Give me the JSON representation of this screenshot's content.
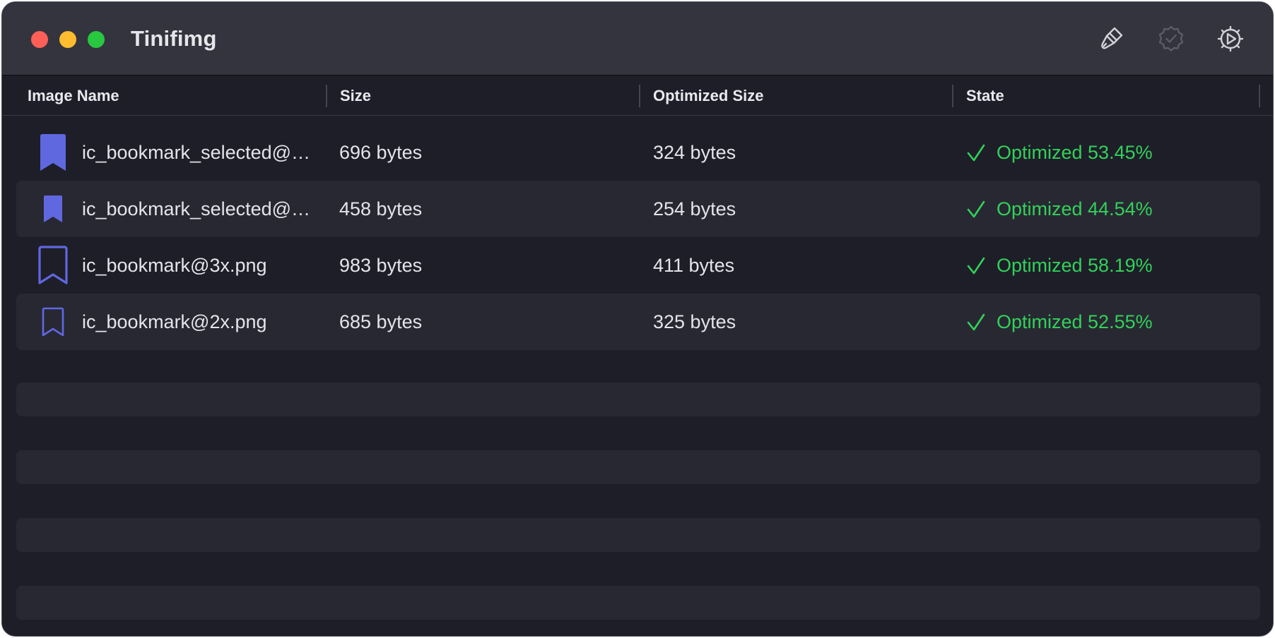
{
  "window": {
    "title": "Tinifimg",
    "traffic_lights": {
      "close_color": "#fe5f57",
      "minimize_color": "#febc2e",
      "zoom_color": "#28c840"
    }
  },
  "toolbar": {
    "buttons": [
      {
        "icon": "paintbrush-icon",
        "enabled": true
      },
      {
        "icon": "checkmark-seal-icon",
        "enabled": false
      },
      {
        "icon": "gear-icon",
        "enabled": true
      }
    ]
  },
  "table": {
    "columns": [
      "Image Name",
      "Size",
      "Optimized Size",
      "State"
    ],
    "rows": [
      {
        "icon": "bookmark-filled-icon",
        "name": "ic_bookmark_selected@…",
        "size": "696 bytes",
        "optimized_size": "324 bytes",
        "state": "Optimized 53.45%"
      },
      {
        "icon": "bookmark-filled-icon",
        "name": "ic_bookmark_selected@…",
        "size": "458 bytes",
        "optimized_size": "254 bytes",
        "state": "Optimized 44.54%"
      },
      {
        "icon": "bookmark-outline-icon",
        "name": "ic_bookmark@3x.png",
        "size": "983 bytes",
        "optimized_size": "411 bytes",
        "state": "Optimized 58.19%"
      },
      {
        "icon": "bookmark-outline-icon",
        "name": "ic_bookmark@2x.png",
        "size": "685 bytes",
        "optimized_size": "325 bytes",
        "state": "Optimized 52.55%"
      }
    ]
  },
  "colors": {
    "background": "#1e1e29",
    "titlebar": "#34343f",
    "row_alt": "#282833",
    "accent_icon": "#6068e0",
    "success": "#32d158",
    "text": "#e4e4ea"
  }
}
